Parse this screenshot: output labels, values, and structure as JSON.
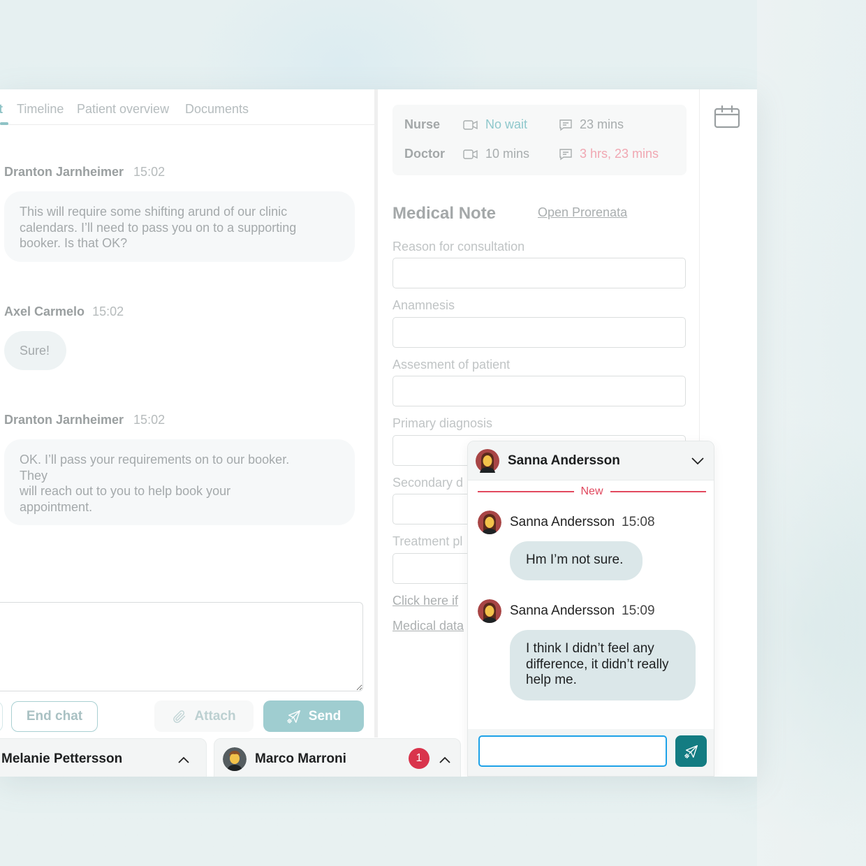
{
  "tabs": [
    {
      "label": "t",
      "active": true
    },
    {
      "label": "Timeline",
      "active": false
    },
    {
      "label": "Patient overview",
      "active": false
    },
    {
      "label": "Documents",
      "active": false
    }
  ],
  "chat": {
    "messages": [
      {
        "author": "Dranton Jarnheimer",
        "time": "15:02",
        "lines": [
          "This will require some shifting arund of our clinic",
          "calendars. I’ll need to pass you on to a supporting",
          "booker. Is that OK?"
        ]
      },
      {
        "author": "Axel Carmelo",
        "time": "15:02",
        "lines": [
          "Sure!"
        ]
      },
      {
        "author": "Dranton Jarnheimer",
        "time": "15:02",
        "lines": [
          "OK. I’ll pass your requirements on to our booker.",
          "They",
          "will reach out to you to help book your",
          "appointment."
        ]
      }
    ],
    "compose_value": "",
    "buttons": {
      "end_chat": "End chat",
      "attach": "Attach",
      "send": "Send"
    }
  },
  "dock": [
    {
      "name": "Melanie Pettersson",
      "unread": null
    },
    {
      "name": "Marco Marroni",
      "unread": "1"
    }
  ],
  "wait_times": {
    "rows": [
      {
        "role": "Nurse",
        "video": "No wait",
        "chat": "23 mins"
      },
      {
        "role": "Doctor",
        "video": "10 mins",
        "chat": "3 hrs, 23 mins"
      }
    ]
  },
  "medical_note": {
    "title": "Medical Note",
    "open_link": "Open Prorenata",
    "fields": [
      {
        "label": "Reason for consultation",
        "value": ""
      },
      {
        "label": "Anamnesis",
        "value": ""
      },
      {
        "label": "Assesment of patient",
        "value": ""
      },
      {
        "label": "Primary diagnosis",
        "value": ""
      },
      {
        "label": "Secondary d",
        "value": ""
      },
      {
        "label": "Treatment pl",
        "value": ""
      }
    ],
    "links": [
      "Click here if",
      "Medical data"
    ]
  },
  "popup_chat": {
    "name": "Sanna Andersson",
    "new_label": "New",
    "messages": [
      {
        "author": "Sanna Andersson",
        "time": "15:08",
        "lines": [
          "Hm I’m not sure."
        ]
      },
      {
        "author": "Sanna Andersson",
        "time": "15:09",
        "lines": [
          "I think I didn’t feel any",
          "difference, it didn’t really",
          "help me."
        ]
      }
    ],
    "input_value": ""
  },
  "colors": {
    "accent": "#8fc3c6",
    "send_button": "#137c82",
    "alert_red": "#d9344c",
    "input_focus": "#1ea2e8"
  }
}
